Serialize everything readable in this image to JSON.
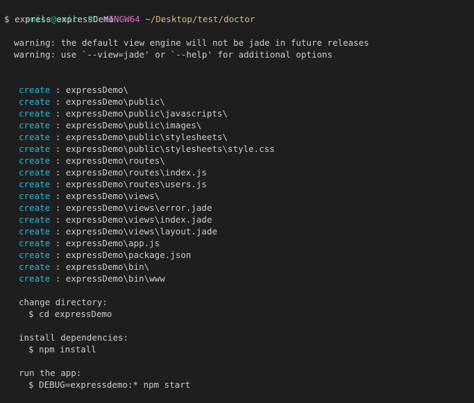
{
  "prompt": {
    "user": "smile@smile-PC",
    "system": "MINGW64",
    "path": "~/Desktop/test/doctor",
    "command": "$ express expressDemo"
  },
  "warnings": [
    "warning: the default view engine will not be jade in future releases",
    "warning: use `--view=jade' or `--help' for additional options"
  ],
  "create_keyword": "create",
  "separator": ":",
  "created_paths": [
    "expressDemo\\",
    "expressDemo\\public\\",
    "expressDemo\\public\\javascripts\\",
    "expressDemo\\public\\images\\",
    "expressDemo\\public\\stylesheets\\",
    "expressDemo\\public\\stylesheets\\style.css",
    "expressDemo\\routes\\",
    "expressDemo\\routes\\index.js",
    "expressDemo\\routes\\users.js",
    "expressDemo\\views\\",
    "expressDemo\\views\\error.jade",
    "expressDemo\\views\\index.jade",
    "expressDemo\\views\\layout.jade",
    "expressDemo\\app.js",
    "expressDemo\\package.json",
    "expressDemo\\bin\\",
    "expressDemo\\bin\\www"
  ],
  "steps": [
    {
      "heading": "change directory:",
      "command": "$ cd expressDemo"
    },
    {
      "heading": "install dependencies:",
      "command": "$ npm install"
    },
    {
      "heading": "run the app:",
      "command": "$ DEBUG=expressdemo:* npm start"
    }
  ],
  "colors": {
    "background": "#1e1e1e",
    "user": "#0dbc79",
    "system": "#d670d6",
    "path": "#d7ba7d",
    "create": "#29b8db",
    "text": "#cccccc"
  }
}
